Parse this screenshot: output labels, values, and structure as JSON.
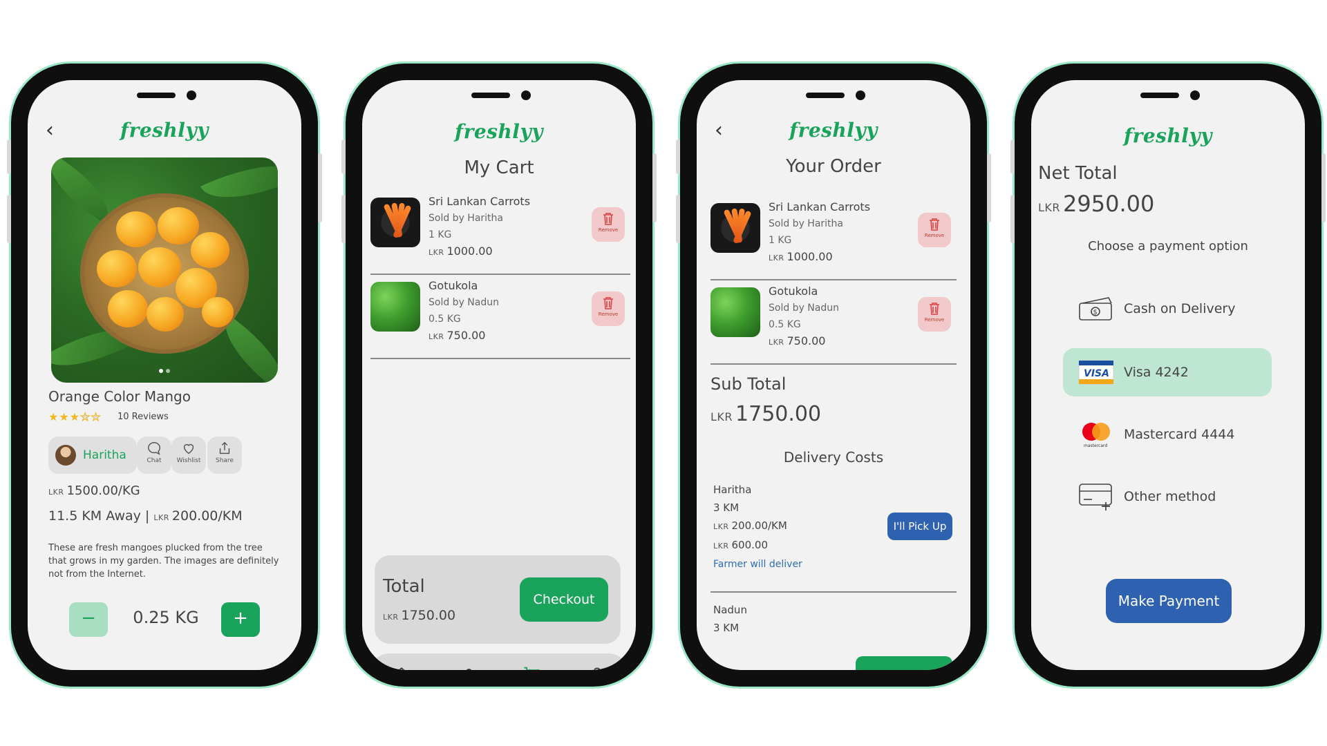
{
  "brand": "freshlyy",
  "product": {
    "name": "Orange Color Mango",
    "stars_filled": 3,
    "stars_total": 5,
    "reviews": "10 Reviews",
    "seller": "Haritha",
    "actions": {
      "chat": "Chat",
      "wishlist": "Wishlist",
      "share": "Share"
    },
    "currency": "LKR",
    "price": "1500.00/KG",
    "distance": "11.5 KM Away |",
    "delivery_rate": "200.00/KM",
    "description": "These are fresh mangoes plucked from the tree that grows in my garden. The images are definitely not from the Internet.",
    "qty_minus": "−",
    "qty_plus": "+",
    "quantity": "0.25 KG"
  },
  "cart": {
    "title": "My Cart",
    "items": [
      {
        "name": "Sri Lankan Carrots",
        "seller": "Sold by Haritha",
        "qty": "1 KG",
        "price": "1000.00",
        "remove": "Remove"
      },
      {
        "name": "Gotukola",
        "seller": "Sold by Nadun",
        "qty": "0.5 KG",
        "price": "750.00",
        "remove": "Remove"
      }
    ],
    "total_label": "Total",
    "total_value": "1750.00",
    "checkout": "Checkout",
    "currency": "LKR"
  },
  "order": {
    "title": "Your Order",
    "subtotal_label": "Sub Total",
    "subtotal_value": "1750.00",
    "delivery_title": "Delivery Costs",
    "farmers": [
      {
        "name": "Haritha",
        "distance": "3 KM",
        "rate": "200.00/KM",
        "cost": "600.00",
        "note": "Farmer will deliver",
        "action": "I'll Pick Up"
      },
      {
        "name": "Nadun",
        "distance": "3 KM"
      }
    ]
  },
  "payment": {
    "net_label": "Net Total",
    "net_value": "2950.00",
    "choose": "Choose a payment option",
    "options": [
      {
        "label": "Cash on Delivery",
        "icon": "cash-icon",
        "selected": false
      },
      {
        "label": "Visa 4242",
        "icon": "visa-icon",
        "selected": true
      },
      {
        "label": "Mastercard 4444",
        "icon": "mastercard-icon",
        "selected": false
      },
      {
        "label": "Other method",
        "icon": "card-add-icon",
        "selected": false
      }
    ],
    "visa_text": "VISA",
    "mastercard_text": "mastercard",
    "make_payment": "Make Payment"
  },
  "colors": {
    "brand_green": "#1aa35a",
    "accent_blue": "#2e62b0",
    "frame_glow": "#9be8c6",
    "selected_bg": "#bfe6d2"
  }
}
